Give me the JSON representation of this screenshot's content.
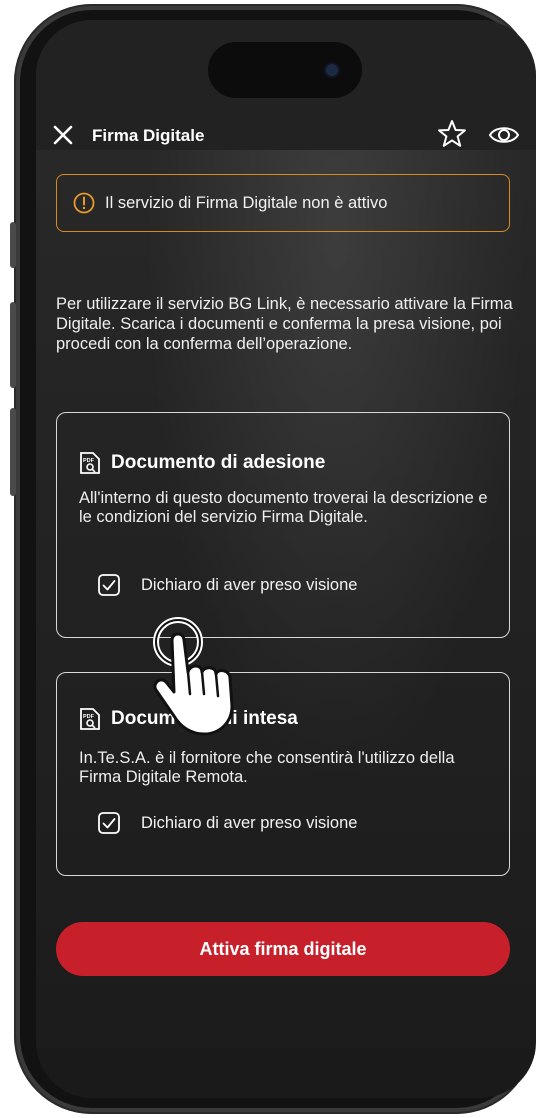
{
  "header": {
    "title": "Firma Digitale",
    "close_icon": "close-icon",
    "favorite_icon": "star-icon",
    "view_icon": "eye-icon"
  },
  "alert": {
    "icon": "warning-circle-icon",
    "text": "Il servizio di Firma Digitale non è attivo",
    "color": "#d98a1e"
  },
  "intro": {
    "text": "Per utilizzare il servizio BG Link, è necessario attivare la Firma Digitale. Scarica i documenti e conferma la presa visione, poi procedi con la conferma dell’operazione."
  },
  "documents": [
    {
      "icon": "pdf-search-icon",
      "title": "Documento di adesione",
      "description": "All'interno di questo documento troverai la descrizione e le condizioni del servizio Firma Digitale.",
      "checkbox_label": "Dichiaro di aver preso visione",
      "checked": true
    },
    {
      "icon": "pdf-search-icon",
      "title": "Documento di intesa",
      "description": "In.Te.S.A. è il fornitore che consentirà l'utilizzo della Firma Digitale Remota.",
      "checkbox_label": "Dichiaro di aver preso visione",
      "checked": true
    }
  ],
  "cta": {
    "label": "Attiva firma digitale",
    "color": "#c8202a"
  },
  "overlay": {
    "icon": "tap-hand-icon"
  }
}
